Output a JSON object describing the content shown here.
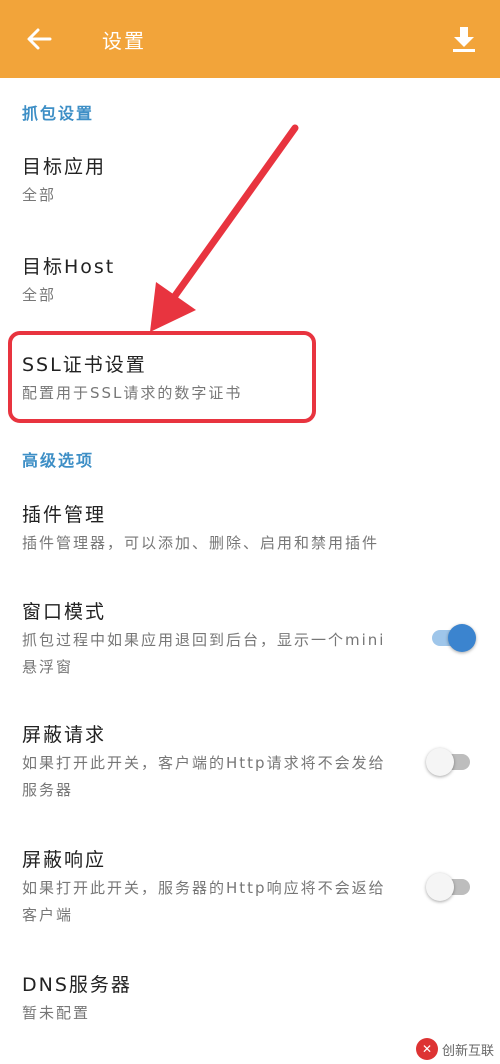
{
  "appbar": {
    "title": "设置"
  },
  "sections": {
    "capture": "抓包设置",
    "advanced": "高级选项"
  },
  "items": {
    "target_app": {
      "title": "目标应用",
      "subtitle": "全部"
    },
    "target_host": {
      "title": "目标Host",
      "subtitle": "全部"
    },
    "ssl_cert": {
      "title": "SSL证书设置",
      "subtitle": "配置用于SSL请求的数字证书"
    },
    "plugins": {
      "title": "插件管理",
      "subtitle": "插件管理器，可以添加、删除、启用和禁用插件"
    },
    "window_mode": {
      "title": "窗口模式",
      "subtitle": "抓包过程中如果应用退回到后台，显示一个mini悬浮窗",
      "toggle": "on"
    },
    "block_request": {
      "title": "屏蔽请求",
      "subtitle": "如果打开此开关，客户端的Http请求将不会发给服务器",
      "toggle": "off"
    },
    "block_response": {
      "title": "屏蔽响应",
      "subtitle": "如果打开此开关，服务器的Http响应将不会返给客户端",
      "toggle": "off"
    },
    "dns": {
      "title": "DNS服务器",
      "subtitle": "暂未配置"
    }
  },
  "watermark": {
    "text": "创新互联"
  },
  "colors": {
    "appbar": "#f2a43a",
    "section": "#3e8fc6",
    "toggle_on": "#3b84cf",
    "highlight": "#e8343f"
  }
}
